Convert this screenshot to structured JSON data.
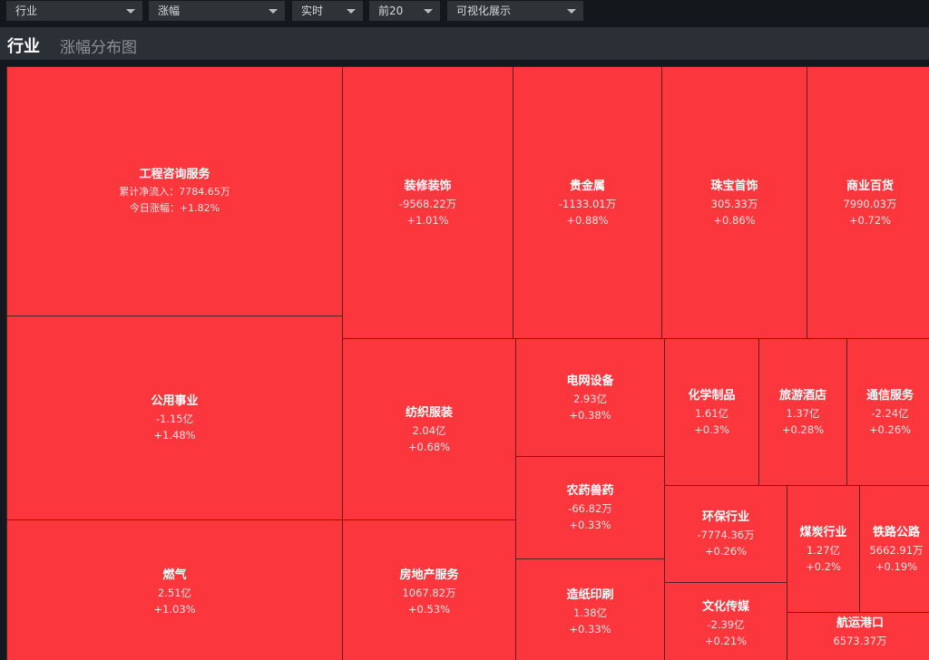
{
  "toolbar": {
    "dropdowns": [
      {
        "name": "industry-select",
        "value": "行业"
      },
      {
        "name": "metric-select",
        "value": "涨幅"
      },
      {
        "name": "time-select",
        "value": "实时"
      },
      {
        "name": "top-n-select",
        "value": "前20"
      },
      {
        "name": "view-select",
        "value": "可视化展示"
      }
    ]
  },
  "header": {
    "title": "行业",
    "subtitle": "涨幅分布图"
  },
  "colors": {
    "tile": "#fb363c",
    "tile_border": "#5a1e1e",
    "background": "#14171c",
    "titlebar": "#2b2f36",
    "dropdown": "#2e3338"
  },
  "tiles": [
    {
      "id": "gcxz",
      "name": "工程咨询服务",
      "flow": "累计净流入：7784.65万",
      "change": "今日涨幅：+1.82%"
    },
    {
      "id": "zxzs",
      "name": "装修装饰",
      "flow": "-9568.22万",
      "change": "+1.01%"
    },
    {
      "id": "gjs",
      "name": "贵金属",
      "flow": "-1133.01万",
      "change": "+0.88%"
    },
    {
      "id": "zbss",
      "name": "珠宝首饰",
      "flow": "305.33万",
      "change": "+0.86%"
    },
    {
      "id": "sybh",
      "name": "商业百货",
      "flow": "7990.03万",
      "change": "+0.72%"
    },
    {
      "id": "gysy",
      "name": "公用事业",
      "flow": "-1.15亿",
      "change": "+1.48%"
    },
    {
      "id": "fzfz",
      "name": "纺织服装",
      "flow": "2.04亿",
      "change": "+0.68%"
    },
    {
      "id": "dwsb",
      "name": "电网设备",
      "flow": "2.93亿",
      "change": "+0.38%"
    },
    {
      "id": "hxzp",
      "name": "化学制品",
      "flow": "1.61亿",
      "change": "+0.3%"
    },
    {
      "id": "lyjd",
      "name": "旅游酒店",
      "flow": "1.37亿",
      "change": "+0.28%"
    },
    {
      "id": "txfw",
      "name": "通信服务",
      "flow": "-2.24亿",
      "change": "+0.26%"
    },
    {
      "id": "nyss",
      "name": "农药兽药",
      "flow": "-66.82万",
      "change": "+0.33%"
    },
    {
      "id": "hbhy",
      "name": "环保行业",
      "flow": "-7774.36万",
      "change": "+0.26%"
    },
    {
      "id": "mthy",
      "name": "煤炭行业",
      "flow": "1.27亿",
      "change": "+0.2%"
    },
    {
      "id": "tlgl",
      "name": "铁路公路",
      "flow": "5662.91万",
      "change": "+0.19%"
    },
    {
      "id": "rq",
      "name": "燃气",
      "flow": "2.51亿",
      "change": "+1.03%"
    },
    {
      "id": "fdcfw",
      "name": "房地产服务",
      "flow": "1067.82万",
      "change": "+0.53%"
    },
    {
      "id": "zzys",
      "name": "造纸印刷",
      "flow": "1.38亿",
      "change": "+0.33%"
    },
    {
      "id": "whcm",
      "name": "文化传媒",
      "flow": "-2.39亿",
      "change": "+0.21%"
    },
    {
      "id": "hygk",
      "name": "航运港口",
      "flow": "6573.37万",
      "change": ""
    }
  ]
}
